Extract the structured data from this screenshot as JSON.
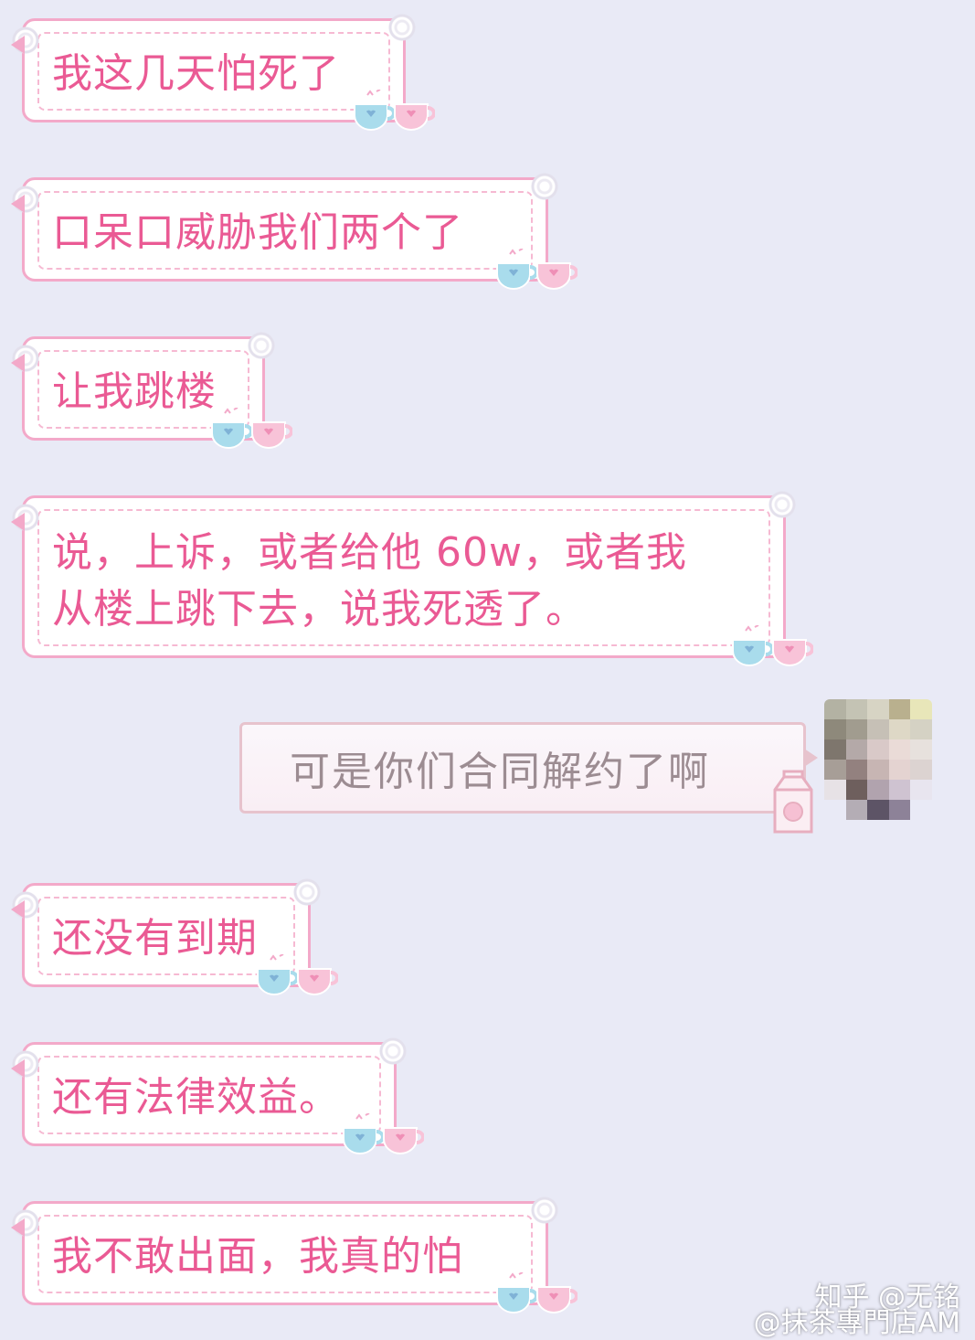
{
  "chat": {
    "messages": [
      {
        "side": "left",
        "text": "我这几天怕死了"
      },
      {
        "side": "left",
        "text": "口呆口威胁我们两个了"
      },
      {
        "side": "left",
        "text": "让我跳楼"
      },
      {
        "side": "left",
        "lines": [
          "说，上诉，或者给他 60w，或者我",
          "从楼上跳下去，说我死透了。"
        ]
      },
      {
        "side": "right",
        "text": "可是你们合同解约了啊"
      },
      {
        "side": "left",
        "text": "还没有到期"
      },
      {
        "side": "left",
        "text": "还有法律效益。"
      },
      {
        "side": "left",
        "text": "我不敢出面，我真的怕"
      }
    ]
  },
  "watermark": {
    "line1": "知乎 @无铭",
    "line2": "@抹茶專門店AM"
  },
  "colors": {
    "background": "#e9eaf6",
    "bubble_border": "#f3a9c9",
    "left_text": "#ea5a94",
    "right_text": "#9c8c92",
    "cup_blue": "#a9dcec",
    "cup_pink": "#f8c3d8"
  },
  "icons": [
    "teacups-icon",
    "milk-carton-icon"
  ]
}
